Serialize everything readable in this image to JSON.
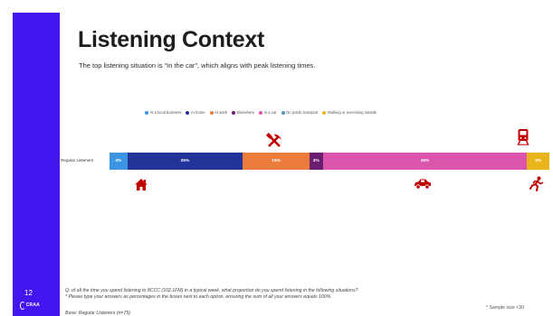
{
  "slide": {
    "page_number": "12",
    "logo_text": "CRAA",
    "title": "Listening Context",
    "subtitle": "The top listening situation is “In the car”, which aligns with peak listening times.",
    "question": "Q: of all the time you spend listening to 8CCC (102.1FM) in a typical week, what proportion do you spend listening in the following situations?",
    "instruction": "* Please type your answers as percentages in the boxes next to each option, ensuring the sum of all your answers equals 100%.",
    "base": "Base: Regular Listeners (n=75)",
    "sample_note": "* Sample size <30"
  },
  "icons": {
    "home": "house-icon",
    "work": "hammer-pick-icon",
    "car": "car-icon",
    "transport": "train-icon",
    "walking": "running-person-icon",
    "icon_color": "#c00000"
  },
  "chart_data": {
    "type": "bar",
    "orientation": "horizontal",
    "stacked": true,
    "categories": [
      "1. Regular Listeners"
    ],
    "series": [
      {
        "name": "At a local business",
        "values": [
          4
        ],
        "label": "4%",
        "color": "#3b95e3"
      },
      {
        "name": "At home",
        "values": [
          26
        ],
        "label": "26%",
        "color": "#22349a"
      },
      {
        "name": "At work",
        "values": [
          15
        ],
        "label": "15%",
        "color": "#ec7c3b"
      },
      {
        "name": "Elsewhere",
        "values": [
          3
        ],
        "label": "3%",
        "color": "#6b1d6f"
      },
      {
        "name": "In a car",
        "values": [
          46
        ],
        "label": "46%",
        "color": "#db55ad"
      },
      {
        "name": "On public transport",
        "values": [
          0
        ],
        "label": "",
        "color": "#4e95c6"
      },
      {
        "name": "Walking or exercising outside",
        "values": [
          5
        ],
        "label": "5%",
        "color": "#e9b51a"
      }
    ],
    "legend_position": "top",
    "xlim": [
      0,
      100
    ],
    "grid": false
  }
}
